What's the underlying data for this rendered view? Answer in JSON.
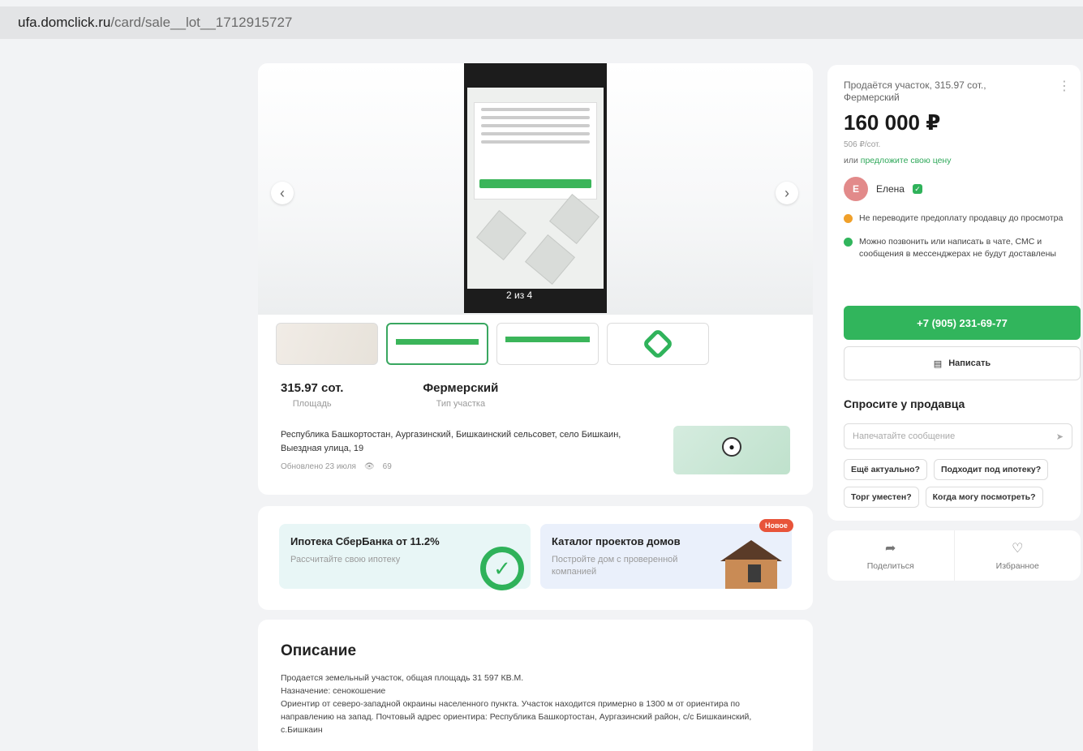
{
  "browser": {
    "url_host": "ufa.domclick.ru",
    "url_path": "/card/sale__lot__1712915727"
  },
  "gallery": {
    "counter": "2 из 4",
    "prev": "‹",
    "next": "›"
  },
  "facts": [
    {
      "value": "315.97 сот.",
      "label": "Площадь"
    },
    {
      "value": "Фермерский",
      "label": "Тип участка"
    }
  ],
  "address": "Республика Башкортостан, Аургазинский, Бишкаинский сельсовет, село Бишкаин, Выездная улица, 19",
  "updated": "Обновлено 23 июля",
  "views": "69",
  "promos": {
    "mortgage": {
      "title": "Ипотека СберБанка от 11.2%",
      "subtitle": "Рассчитайте свою ипотеку"
    },
    "catalog": {
      "title": "Каталог проектов домов",
      "subtitle": "Постройте дом с проверенной компанией",
      "badge": "Новое"
    }
  },
  "description": {
    "heading": "Описание",
    "line1": "Продается земельный участок, общая площадь 31 597 КВ.М.",
    "line2": "Назначение: сенокошение",
    "line3": "Ориентир от северо-западной окраины населенного пункта. Участок находится примерно в 1300 м от ориентира по направлению на запад. Почтовый адрес ориентира: Республика Башкортостан, Аургазинский район, с/с Бишкаинский, с.Бишкаин"
  },
  "sidebar": {
    "title": "Продаётся участок, 315.97 сот., Фермерский",
    "price": "160 000 ₽",
    "per_unit": "506 ₽/сот.",
    "offer_prefix": "или",
    "offer_link": "предложите свою цену",
    "seller_initial": "Е",
    "seller_name": "Елена",
    "warning1": "Не переводите предоплату продавцу до просмотра",
    "warning2": "Можно позвонить или написать в чате, СМС и сообщения в мессенджерах не будут доставлены",
    "phone": "+7 (905) 231-69-77",
    "write": "Написать",
    "ask_title": "Спросите у продавца",
    "ask_placeholder": "Напечатайте сообщение",
    "chips": [
      "Ещё актуально?",
      "Подходит под ипотеку?",
      "Торг уместен?",
      "Когда могу посмотреть?"
    ]
  },
  "actions": {
    "share": "Поделиться",
    "favorite": "Избранное"
  },
  "colors": {
    "accent": "#31b55c",
    "badge": "#e8543a"
  }
}
